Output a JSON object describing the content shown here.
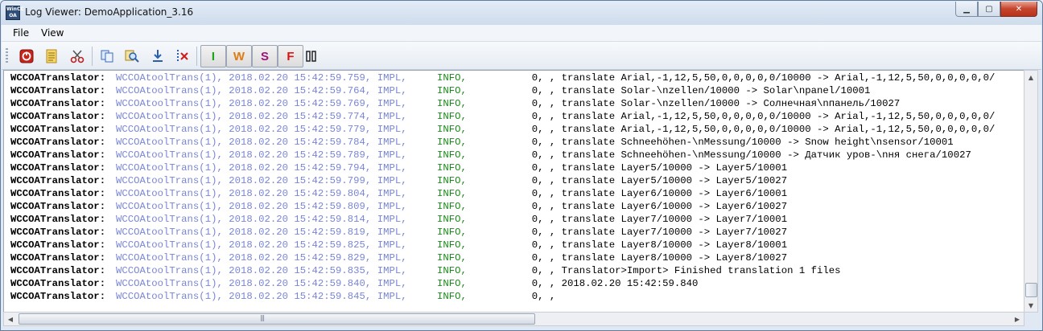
{
  "window": {
    "title": "Log Viewer: DemoApplication_3.16",
    "app_icon_text": "WinCC OA",
    "minimize_glyph": "▁",
    "maximize_glyph": "▢",
    "close_glyph": "✕"
  },
  "menu": [
    {
      "label": "File"
    },
    {
      "label": "View"
    }
  ],
  "toolbar": {
    "icons": [
      "stop-icon",
      "notes-icon",
      "scissors-icon",
      "copy-icon",
      "search-icon",
      "download-icon",
      "clear-icon"
    ],
    "filters": [
      {
        "label": "I",
        "color": "#1aa51a"
      },
      {
        "label": "W",
        "color": "#e07b10"
      },
      {
        "label": "S",
        "color": "#a0107a"
      },
      {
        "label": "F",
        "color": "#e01010"
      }
    ],
    "columns_icon": "columns-icon"
  },
  "log": {
    "rows": [
      {
        "module": "WCCOATranslator:",
        "source": "WCCOAtoolTrans(1), 2018.02.20 15:42:59.759, IMPL,",
        "severity": "INFO,",
        "message": "  0, , translate Arial,-1,12,5,50,0,0,0,0,0/10000 -> Arial,-1,12,5,50,0,0,0,0,0/"
      },
      {
        "module": "WCCOATranslator:",
        "source": "WCCOAtoolTrans(1), 2018.02.20 15:42:59.764, IMPL,",
        "severity": "INFO,",
        "message": "  0, , translate Solar-\\nzellen/10000 -> Solar\\npanel/10001"
      },
      {
        "module": "WCCOATranslator:",
        "source": "WCCOAtoolTrans(1), 2018.02.20 15:42:59.769, IMPL,",
        "severity": "INFO,",
        "message": "  0, , translate Solar-\\nzellen/10000 -> Солнечная\\nпанель/10027"
      },
      {
        "module": "WCCOATranslator:",
        "source": "WCCOAtoolTrans(1), 2018.02.20 15:42:59.774, IMPL,",
        "severity": "INFO,",
        "message": "  0, , translate Arial,-1,12,5,50,0,0,0,0,0/10000 -> Arial,-1,12,5,50,0,0,0,0,0/"
      },
      {
        "module": "WCCOATranslator:",
        "source": "WCCOAtoolTrans(1), 2018.02.20 15:42:59.779, IMPL,",
        "severity": "INFO,",
        "message": "  0, , translate Arial,-1,12,5,50,0,0,0,0,0/10000 -> Arial,-1,12,5,50,0,0,0,0,0/"
      },
      {
        "module": "WCCOATranslator:",
        "source": "WCCOAtoolTrans(1), 2018.02.20 15:42:59.784, IMPL,",
        "severity": "INFO,",
        "message": "  0, , translate Schneehöhen-\\nMessung/10000 -> Snow height\\nsensor/10001"
      },
      {
        "module": "WCCOATranslator:",
        "source": "WCCOAtoolTrans(1), 2018.02.20 15:42:59.789, IMPL,",
        "severity": "INFO,",
        "message": "  0, , translate Schneehöhen-\\nMessung/10000 -> Датчик уров-\\nня снега/10027"
      },
      {
        "module": "WCCOATranslator:",
        "source": "WCCOAtoolTrans(1), 2018.02.20 15:42:59.794, IMPL,",
        "severity": "INFO,",
        "message": "  0, , translate Layer5/10000 -> Layer5/10001"
      },
      {
        "module": "WCCOATranslator:",
        "source": "WCCOAtoolTrans(1), 2018.02.20 15:42:59.799, IMPL,",
        "severity": "INFO,",
        "message": "  0, , translate Layer5/10000 -> Layer5/10027"
      },
      {
        "module": "WCCOATranslator:",
        "source": "WCCOAtoolTrans(1), 2018.02.20 15:42:59.804, IMPL,",
        "severity": "INFO,",
        "message": "  0, , translate Layer6/10000 -> Layer6/10001"
      },
      {
        "module": "WCCOATranslator:",
        "source": "WCCOAtoolTrans(1), 2018.02.20 15:42:59.809, IMPL,",
        "severity": "INFO,",
        "message": "  0, , translate Layer6/10000 -> Layer6/10027"
      },
      {
        "module": "WCCOATranslator:",
        "source": "WCCOAtoolTrans(1), 2018.02.20 15:42:59.814, IMPL,",
        "severity": "INFO,",
        "message": "  0, , translate Layer7/10000 -> Layer7/10001"
      },
      {
        "module": "WCCOATranslator:",
        "source": "WCCOAtoolTrans(1), 2018.02.20 15:42:59.819, IMPL,",
        "severity": "INFO,",
        "message": "  0, , translate Layer7/10000 -> Layer7/10027"
      },
      {
        "module": "WCCOATranslator:",
        "source": "WCCOAtoolTrans(1), 2018.02.20 15:42:59.825, IMPL,",
        "severity": "INFO,",
        "message": "  0, , translate Layer8/10000 -> Layer8/10001"
      },
      {
        "module": "WCCOATranslator:",
        "source": "WCCOAtoolTrans(1), 2018.02.20 15:42:59.829, IMPL,",
        "severity": "INFO,",
        "message": "  0, , translate Layer8/10000 -> Layer8/10027"
      },
      {
        "module": "WCCOATranslator:",
        "source": "WCCOAtoolTrans(1), 2018.02.20 15:42:59.835, IMPL,",
        "severity": "INFO,",
        "message": "  0, , Translator>Import> Finished translation 1 files"
      },
      {
        "module": "WCCOATranslator:",
        "source": "WCCOAtoolTrans(1), 2018.02.20 15:42:59.840, IMPL,",
        "severity": "INFO,",
        "message": "  0, , 2018.02.20 15:42:59.840"
      },
      {
        "module": "WCCOATranslator:",
        "source": "WCCOAtoolTrans(1), 2018.02.20 15:42:59.845, IMPL,",
        "severity": "INFO,",
        "message": "  0, ,"
      }
    ]
  },
  "scrollbars": {
    "vertical_position": 0.97,
    "horizontal_position": 0.0,
    "horizontal_visible_fraction": 0.5,
    "grip_glyph": "|||"
  },
  "colors": {
    "source_text": "#7a86d4",
    "severity_info": "#1a8a1a"
  }
}
